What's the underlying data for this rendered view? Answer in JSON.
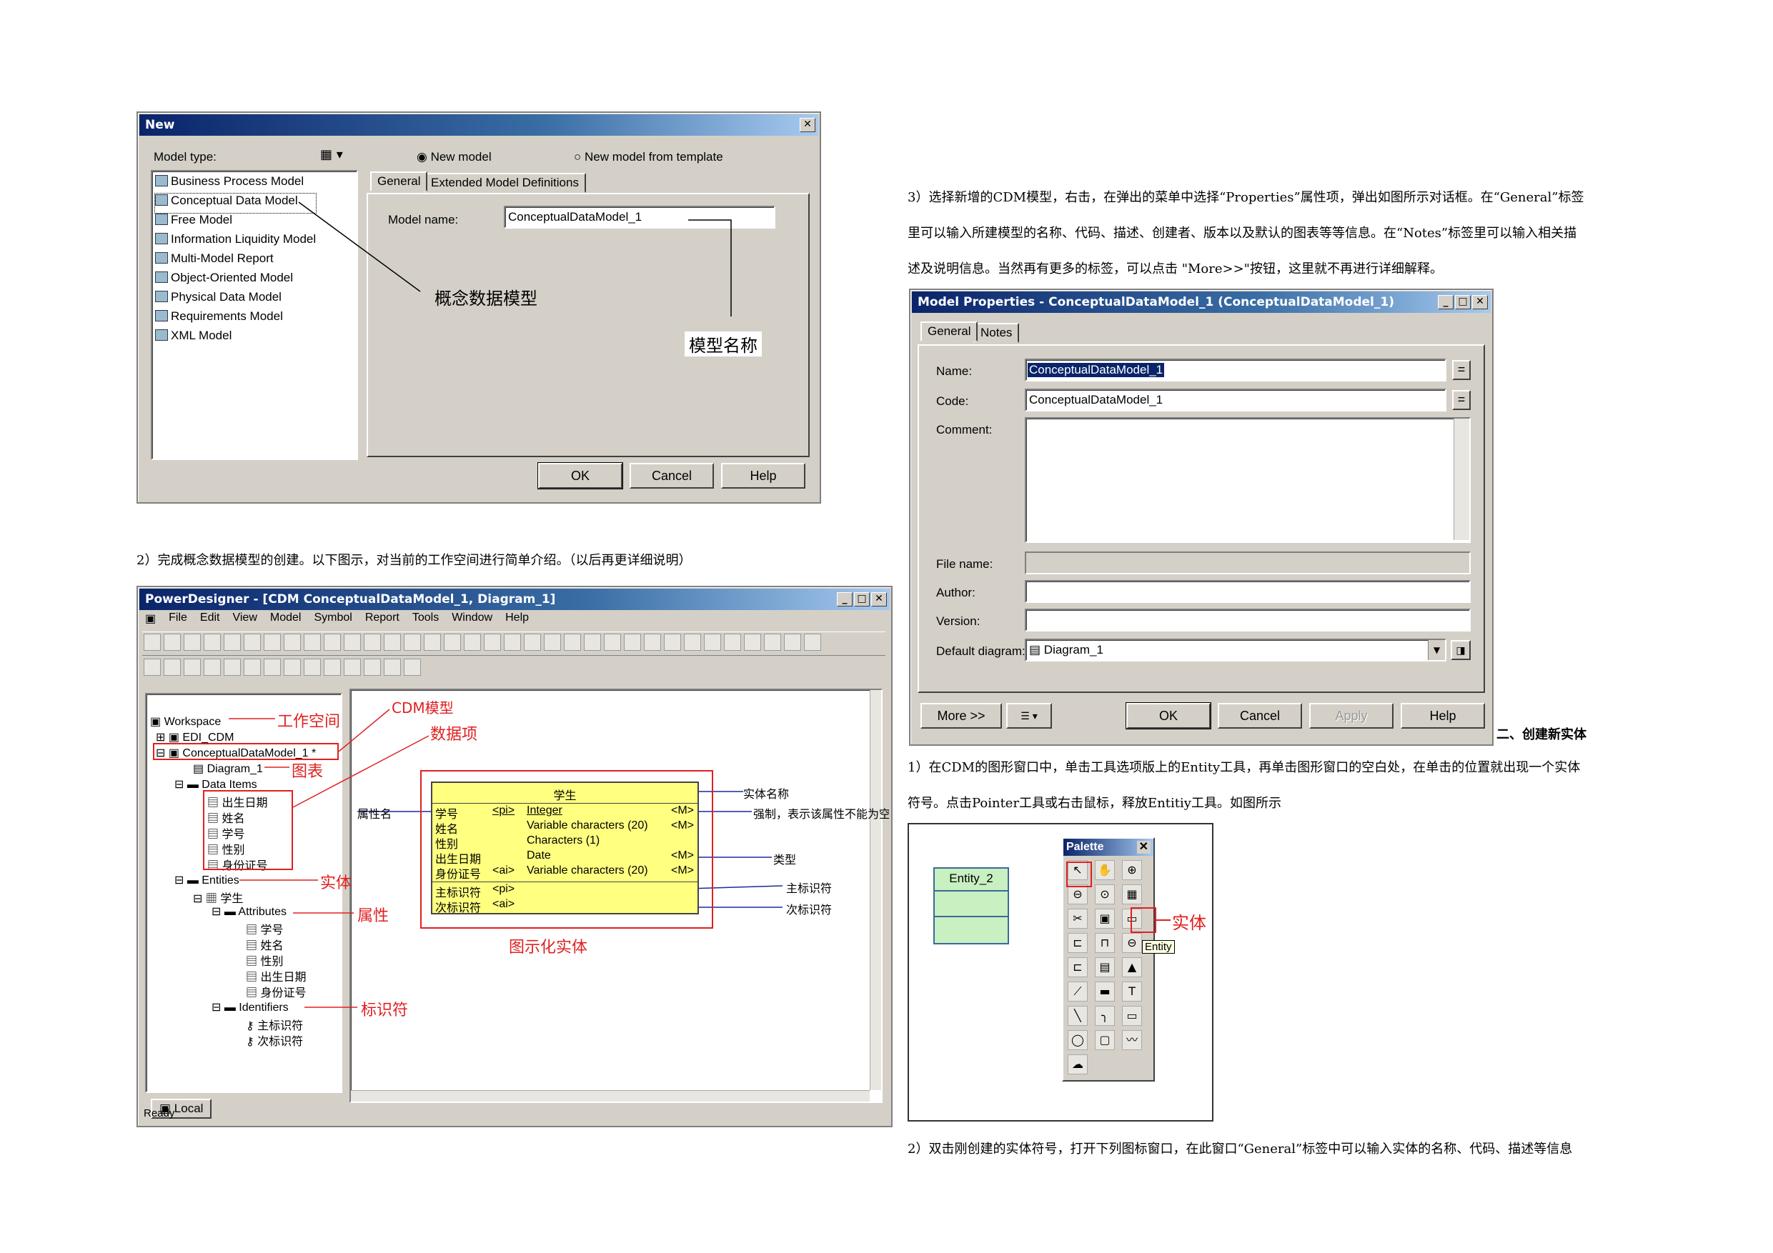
{
  "new_dialog": {
    "title": "New",
    "model_type_label": "Model type:",
    "models": [
      "Business Process Model",
      "Conceptual Data Model",
      "Free Model",
      "Information Liquidity Model",
      "Multi-Model Report",
      "Object-Oriented Model",
      "Physical Data Model",
      "Requirements Model",
      "XML Model"
    ],
    "radio_new": "New model",
    "radio_template": "New model from template",
    "tabs": [
      "General",
      "Extended Model Definitions"
    ],
    "model_name_label": "Model name:",
    "model_name_value": "ConceptualDataModel_1",
    "annot_cdm": "概念数据模型",
    "annot_name": "模型名称",
    "ok": "OK",
    "cancel": "Cancel",
    "help": "Help"
  },
  "para2": "2）完成概念数据模型的创建。以下图示，对当前的工作空间进行简单介绍。（以后再更详细说明）",
  "para3_line1": "3）选择新增的CDM模型，右击，在弹出的菜单中选择“Properties”属性项，弹出如图所示对话框。在“General”标签",
  "para3_line2": "里可以输入所建模型的名称、代码、描述、创建者、版本以及默认的图表等等信息。在“Notes”标签里可以输入相关描",
  "para3_line3": "述及说明信息。当然再有更多的标签，可以点击 \"More>>\"按钮，这里就不再进行详细解释。",
  "props": {
    "title": "Model Properties - ConceptualDataModel_1 (ConceptualDataModel_1)",
    "tabs": [
      "General",
      "Notes"
    ],
    "name_label": "Name:",
    "name_value": "ConceptualDataModel_1",
    "code_label": "Code:",
    "code_value": "ConceptualDataModel_1",
    "comment_label": "Comment:",
    "file_label": "File name:",
    "author_label": "Author:",
    "version_label": "Version:",
    "diagram_label": "Default diagram:",
    "diagram_value": "Diagram_1",
    "more": "More >>",
    "ok": "OK",
    "cancel": "Cancel",
    "apply": "Apply",
    "help": "Help"
  },
  "section2_title": "二、创建新实体",
  "sec2_line1": "1）在CDM的图形窗口中，单击工具选项版上的Entity工具，再单击图形窗口的空白处，在单击的位置就出现一个实体",
  "sec2_line2": "符号。点击Pointer工具或右击鼠标，释放Entitiy工具。如图所示",
  "sec2_line3": "2）双击刚创建的实体符号，打开下列图标窗口，在此窗口“General”标签中可以输入实体的名称、代码、描述等信息",
  "pd": {
    "title": "PowerDesigner - [CDM ConceptualDataModel_1, Diagram_1]",
    "menu": [
      "File",
      "Edit",
      "View",
      "Model",
      "Symbol",
      "Report",
      "Tools",
      "Window",
      "Help"
    ],
    "tree": {
      "workspace": "Workspace",
      "edi": "EDI_CDM",
      "cdm": "ConceptualDataModel_1 *",
      "diagram": "Diagram_1",
      "data_items": "Data Items",
      "items": [
        "出生日期",
        "姓名",
        "学号",
        "性别",
        "身份证号"
      ],
      "entities": "Entities",
      "student": "学生",
      "attributes": "Attributes",
      "attrs": [
        "学号",
        "姓名",
        "性别",
        "出生日期",
        "身份证号"
      ],
      "identifiers": "Identifiers",
      "ids": [
        "主标识符",
        "次标识符"
      ]
    },
    "local_tab": "Local",
    "status": "Ready",
    "annots": {
      "workspace": "工作空间",
      "cdm": "CDM模型",
      "data_items": "数据项",
      "diagram": "图表",
      "entity": "实体",
      "attribute": "属性",
      "identifier": "标识符",
      "graphic": "图示化实体",
      "attr_name": "属性名",
      "entity_name": "实体名称",
      "mandatory": "强制，表示该属性不能为空",
      "type": "类型",
      "primary": "主标识符",
      "secondary": "次标识符"
    },
    "entity": {
      "name": "学生",
      "rows": [
        {
          "name": "学号",
          "key": "<pi>",
          "type": "Integer",
          "m": "<M>"
        },
        {
          "name": "姓名",
          "key": "",
          "type": "Variable characters (20)",
          "m": "<M>"
        },
        {
          "name": "性别",
          "key": "",
          "type": "Characters (1)",
          "m": ""
        },
        {
          "name": "出生日期",
          "key": "",
          "type": "Date",
          "m": "<M>"
        },
        {
          "name": "身份证号",
          "key": "<ai>",
          "type": "Variable characters (20)",
          "m": "<M>"
        }
      ],
      "ids": [
        {
          "name": "主标识符",
          "key": "<pi>"
        },
        {
          "name": "次标识符",
          "key": "<ai>"
        }
      ]
    }
  },
  "palette": {
    "title": "Palette",
    "entity_label": "Entity_2",
    "annot": "实体",
    "tooltip": "Entity"
  }
}
